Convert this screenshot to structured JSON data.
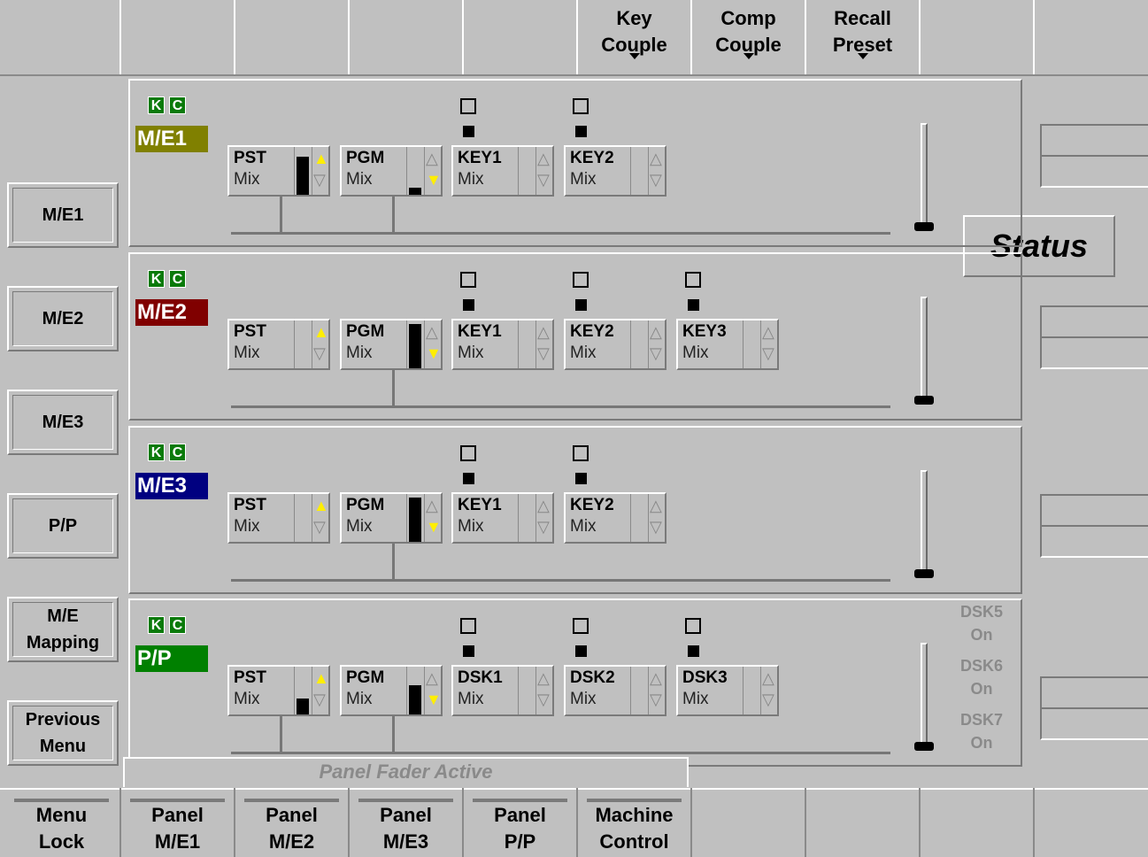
{
  "top_buttons": [
    {
      "line1": "Key",
      "line2": "Couple"
    },
    {
      "line1": "Comp",
      "line2": "Couple"
    },
    {
      "line1": "Recall",
      "line2": "Preset"
    }
  ],
  "side_buttons": {
    "me1": "M/E1",
    "me2": "M/E2",
    "me3": "M/E3",
    "pp": "P/P",
    "me_mapping": [
      "M/E",
      "Mapping"
    ],
    "previous_menu": [
      "Previous",
      "Menu"
    ]
  },
  "status_label": "Status",
  "kc": {
    "k": "K",
    "c": "C"
  },
  "panels": [
    {
      "label": "M/E1",
      "color": "#808000",
      "pst": {
        "name": "PST",
        "mode": "Mix",
        "level": 0.85,
        "up_on": true,
        "dn_on": false
      },
      "pgm": {
        "name": "PGM",
        "mode": "Mix",
        "level": 0.15,
        "up_on": false,
        "dn_on": true
      },
      "keys": [
        {
          "name": "KEY1",
          "mode": "Mix"
        },
        {
          "name": "KEY2",
          "mode": "Mix"
        }
      ]
    },
    {
      "label": "M/E2",
      "color": "#800000",
      "pst": {
        "name": "PST",
        "mode": "Mix",
        "level": 0,
        "up_on": true,
        "dn_on": false
      },
      "pgm": {
        "name": "PGM",
        "mode": "Mix",
        "level": 1,
        "up_on": false,
        "dn_on": true
      },
      "keys": [
        {
          "name": "KEY1",
          "mode": "Mix"
        },
        {
          "name": "KEY2",
          "mode": "Mix"
        },
        {
          "name": "KEY3",
          "mode": "Mix"
        }
      ]
    },
    {
      "label": "M/E3",
      "color": "#000080",
      "pst": {
        "name": "PST",
        "mode": "Mix",
        "level": 0,
        "up_on": true,
        "dn_on": false
      },
      "pgm": {
        "name": "PGM",
        "mode": "Mix",
        "level": 1,
        "up_on": false,
        "dn_on": true
      },
      "keys": [
        {
          "name": "KEY1",
          "mode": "Mix"
        },
        {
          "name": "KEY2",
          "mode": "Mix"
        }
      ]
    },
    {
      "label": "P/P",
      "color": "#008000",
      "pst": {
        "name": "PST",
        "mode": "Mix",
        "level": 0.35,
        "up_on": true,
        "dn_on": false
      },
      "pgm": {
        "name": "PGM",
        "mode": "Mix",
        "level": 0.65,
        "up_on": false,
        "dn_on": true
      },
      "keys": [
        {
          "name": "DSK1",
          "mode": "Mix"
        },
        {
          "name": "DSK2",
          "mode": "Mix"
        },
        {
          "name": "DSK3",
          "mode": "Mix"
        }
      ]
    }
  ],
  "dsk_status": [
    {
      "name": "DSK5",
      "state": "On"
    },
    {
      "name": "DSK6",
      "state": "On"
    },
    {
      "name": "DSK7",
      "state": "On"
    }
  ],
  "panel_fader_status": "Panel Fader Active",
  "bottom_buttons": [
    {
      "line1": "Menu",
      "line2": "Lock"
    },
    {
      "line1": "Panel",
      "line2": "M/E1"
    },
    {
      "line1": "Panel",
      "line2": "M/E2"
    },
    {
      "line1": "Panel",
      "line2": "M/E3"
    },
    {
      "line1": "Panel",
      "line2": "P/P"
    },
    {
      "line1": "Machine",
      "line2": "Control"
    }
  ]
}
